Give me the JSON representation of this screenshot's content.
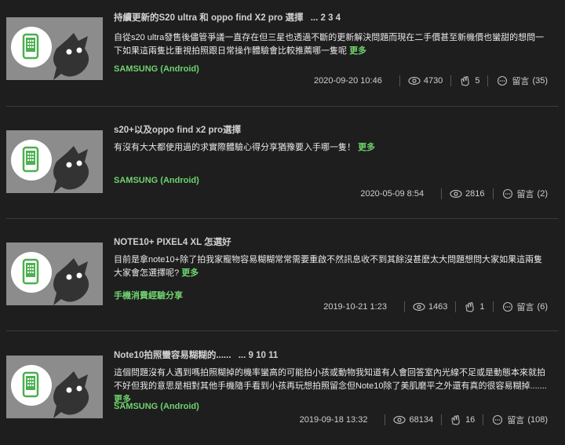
{
  "threads": [
    {
      "title": "持續更新的S20 ultra 和 oppo find X2 pro 選擇",
      "pages": "...  2  3  4",
      "excerpt": "自從s20 ultra發售後儘管爭議一直存在但三星也透過不斷的更新解決問題而現在二手價甚至新機價也蠻甜的想問一下如果這兩隻比重視拍照跟日常操作體驗會比較推薦哪一隻呢",
      "more": "更多",
      "category": "SAMSUNG (Android)",
      "date": "2020-09-20 10:46",
      "views": "4730",
      "likes": "5",
      "replies_label": "留言",
      "replies": "(35)"
    },
    {
      "title": "s20+以及oppo find x2 pro選擇",
      "pages": "",
      "excerpt": "有沒有大大都使用過的求實際體驗心得分享猶豫要入手哪一隻！",
      "more": "更多",
      "category": "SAMSUNG (Android)",
      "date": "2020-05-09 8:54",
      "views": "2816",
      "likes": "",
      "replies_label": "留言",
      "replies": "(2)"
    },
    {
      "title": "NOTE10+ PIXEL4 XL 怎選好",
      "pages": "",
      "excerpt": "目前是拿note10+除了拍我家寵物容易糊糊常常需要重啟不然訊息收不到其餘沒甚麼太大問題想問大家如果這兩隻大家會怎選擇呢?",
      "more": "更多",
      "category": "手機消費經驗分享",
      "date": "2019-10-21 1:23",
      "views": "1463",
      "likes": "1",
      "replies_label": "留言",
      "replies": "(6)"
    },
    {
      "title": "Note10拍照蠻容易糊糊的......",
      "pages": "...  9  10  11",
      "excerpt": "這個問題沒有人遇到嗎拍照糊掉的機率蠻高的可能拍小孩或動物我知道有人會回答室內光線不足或是動態本來就拍不好但我的意思是相對其他手機隨手看到小孩再玩想拍照留念但Note10除了美肌磨平之外還有真的很容易糊掉.......",
      "more": "更多",
      "category": "SAMSUNG (Android)",
      "date": "2019-09-18 13:32",
      "views": "68134",
      "likes": "16",
      "replies_label": "留言",
      "replies": "(108)"
    }
  ]
}
